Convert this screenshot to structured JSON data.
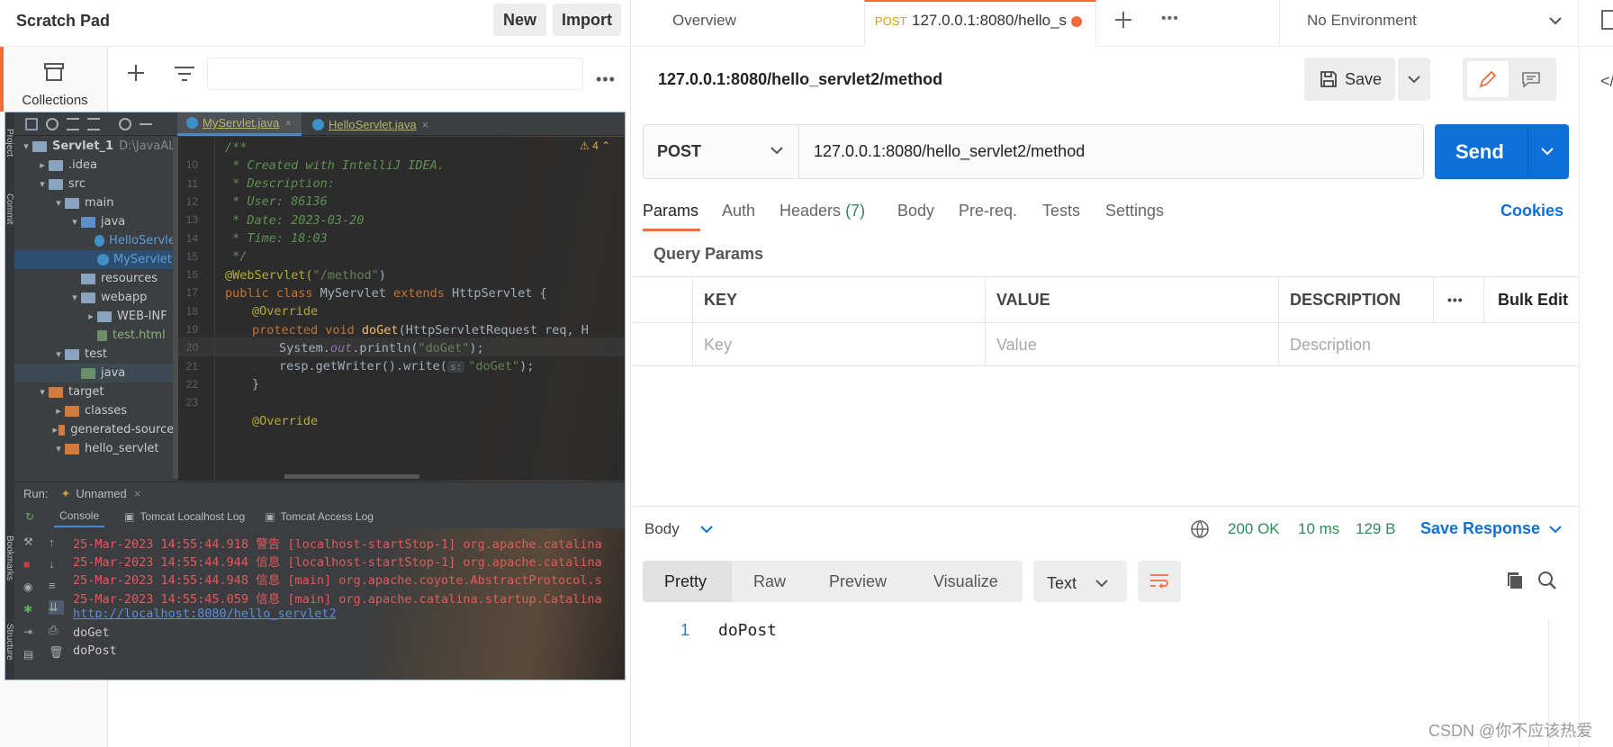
{
  "scratch": {
    "title": "Scratch Pad",
    "new_label": "New",
    "import_label": "Import",
    "rail_label": "Collections"
  },
  "ide": {
    "tabs": [
      {
        "label": "MyServlet.java"
      },
      {
        "label": "HelloServlet.java"
      }
    ],
    "warning": "4",
    "side_labels": [
      "Project",
      "Commit",
      "Bookmarks",
      "Structure"
    ],
    "tree": [
      {
        "label": "Servlet_1",
        "extra": "D:\\JavaAL\\",
        "indent": 0,
        "kind": "root",
        "arrow": "▾"
      },
      {
        "label": ".idea",
        "indent": 1,
        "kind": "folder",
        "arrow": "▸"
      },
      {
        "label": "src",
        "indent": 1,
        "kind": "folder",
        "arrow": "▾"
      },
      {
        "label": "main",
        "indent": 2,
        "kind": "folder",
        "arrow": "▾"
      },
      {
        "label": "java",
        "indent": 3,
        "kind": "blue",
        "arrow": "▾"
      },
      {
        "label": "HelloServlet",
        "indent": 4,
        "kind": "class",
        "arrow": ""
      },
      {
        "label": "MyServlet",
        "indent": 4,
        "kind": "class",
        "arrow": "",
        "sel": true
      },
      {
        "label": "resources",
        "indent": 3,
        "kind": "folder",
        "arrow": ""
      },
      {
        "label": "webapp",
        "indent": 3,
        "kind": "folder",
        "arrow": "▾"
      },
      {
        "label": "WEB-INF",
        "indent": 4,
        "kind": "folder",
        "arrow": "▸"
      },
      {
        "label": "test.html",
        "indent": 4,
        "kind": "file",
        "arrow": ""
      },
      {
        "label": "test",
        "indent": 2,
        "kind": "folder",
        "arrow": "▾"
      },
      {
        "label": "java",
        "indent": 3,
        "kind": "green",
        "arrow": "",
        "sel2": true
      },
      {
        "label": "target",
        "indent": 1,
        "kind": "orange",
        "arrow": "▾"
      },
      {
        "label": "classes",
        "indent": 2,
        "kind": "orange",
        "arrow": "▸"
      },
      {
        "label": "generated-sources",
        "indent": 2,
        "kind": "orange",
        "arrow": "▸"
      },
      {
        "label": "hello_servlet",
        "indent": 2,
        "kind": "orange",
        "arrow": "▾"
      }
    ],
    "code": [
      {
        "n": "",
        "t": "/**",
        "c": "cm"
      },
      {
        "n": "10",
        "t": " * Created with IntelliJ IDEA.",
        "c": "cm"
      },
      {
        "n": "11",
        "t": " * Description:",
        "c": "cm"
      },
      {
        "n": "12",
        "t": " * User: 86136",
        "c": "cm"
      },
      {
        "n": "13",
        "t": " * Date: 2023-03-20",
        "c": "cm"
      },
      {
        "n": "14",
        "t": " * Time: 18:03",
        "c": "cm"
      },
      {
        "n": "15",
        "t": " */",
        "c": "cm"
      }
    ],
    "code2": {
      "l16a": "@WebServlet(",
      "l16b": "\"/method\"",
      "l16c": ")",
      "l17a": "public class ",
      "l17b": "MyServlet ",
      "l17c": "extends ",
      "l17d": "HttpServlet {",
      "l18": "@Override",
      "l19a": "protected void ",
      "l19b": "doGet",
      "l19c": "(HttpServletRequest req, H",
      "l20a": "System.",
      "l20b": "out",
      "l20c": ".println(",
      "l20d": "\"doGet\"",
      "l20e": ");",
      "l21a": "resp.getWriter().write(",
      "l21h": "s:",
      "l21b": "\"doGet\"",
      "l21c": ");",
      "l22": "}",
      "l24": "@Override",
      "nums": [
        "16",
        "17",
        "18",
        "19",
        "20",
        "21",
        "22",
        "23"
      ]
    },
    "run": {
      "label": "Run:",
      "config": "Unnamed",
      "tabs": [
        "Console",
        "Tomcat Localhost Log",
        "Tomcat Access Log"
      ]
    },
    "logs": [
      "25-Mar-2023 14:55:44.918 警告 [localhost-startStop-1] org.apache.catalina",
      "25-Mar-2023 14:55:44.944 信息 [localhost-startStop-1] org.apache.catalina",
      "25-Mar-2023 14:55:44.948 信息 [main] org.apache.coyote.AbstractProtocol.s",
      "25-Mar-2023 14:55:45.059 信息 [main] org.apache.catalina.startup.Catalina"
    ],
    "link": "http://localhost:8080/hello_servlet2",
    "out": [
      "doGet",
      "doPost"
    ]
  },
  "topbar": {
    "overview": "Overview",
    "tab_method": "POST",
    "tab_url": "127.0.0.1:8080/hello_s",
    "env": "No Environment"
  },
  "request": {
    "title": "127.0.0.1:8080/hello_servlet2/method",
    "save": "Save",
    "method": "POST",
    "url": "127.0.0.1:8080/hello_servlet2/method",
    "send": "Send",
    "tabs": [
      "Params",
      "Auth",
      "Headers",
      "Body",
      "Pre-req.",
      "Tests",
      "Settings"
    ],
    "headers_count": "(7)",
    "cookies": "Cookies",
    "query_params": "Query Params",
    "cols": {
      "key": "KEY",
      "value": "VALUE",
      "desc": "DESCRIPTION",
      "bulk": "Bulk Edit"
    },
    "ph": {
      "key": "Key",
      "value": "Value",
      "desc": "Description"
    }
  },
  "response": {
    "body": "Body",
    "status": "200 OK",
    "time": "10 ms",
    "size": "129 B",
    "save_resp": "Save Response",
    "views": [
      "Pretty",
      "Raw",
      "Preview",
      "Visualize"
    ],
    "format": "Text",
    "line_no": "1",
    "content": "doPost"
  },
  "watermark": "CSDN @你不应该热爱",
  "colors": {
    "accent": "#0d6fd8",
    "orange": "#f26b3a",
    "green": "#2e8b57"
  }
}
